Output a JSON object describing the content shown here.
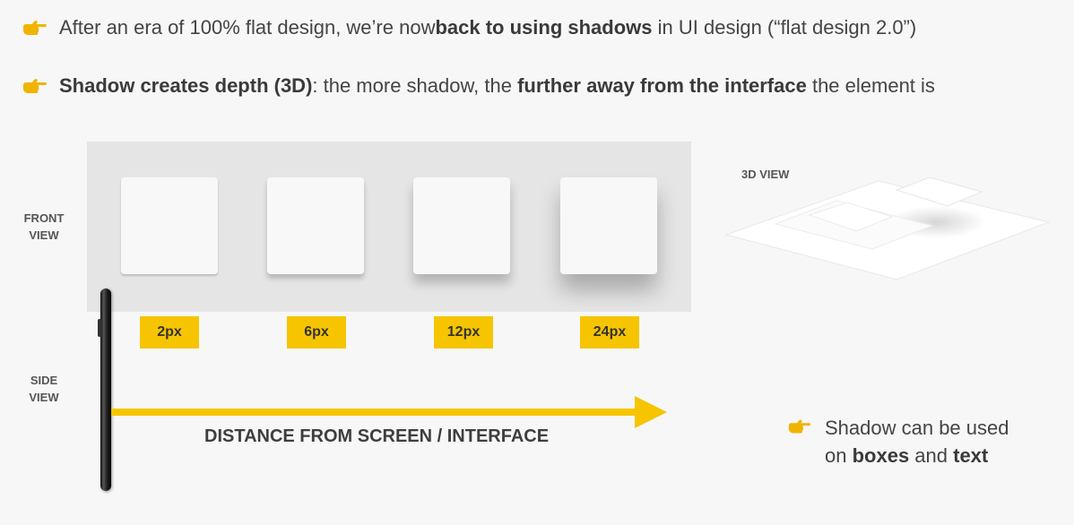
{
  "bullets": [
    {
      "prefix": "After an era of 100% flat design, we’re now ",
      "bold": "back to using shadows",
      "suffix": " in UI design (“flat design 2.0”)"
    },
    {
      "bold1": "Shadow creates depth (3D)",
      "mid": ": the more shadow, the ",
      "bold2": "further away from the interface",
      "suffix": " the element is"
    }
  ],
  "front_view_label_line1": "FRONT",
  "front_view_label_line2": "VIEW",
  "side_view_label_line1": "SIDE",
  "side_view_label_line2": "VIEW",
  "shadow_sizes": [
    "2px",
    "6px",
    "12px",
    "24px"
  ],
  "distance_label": "DISTANCE FROM SCREEN / INTERFACE",
  "view_3d_label": "3D VIEW",
  "note": {
    "line1": "Shadow can be used",
    "on": "on ",
    "boxes": "boxes",
    "and": " and ",
    "text": "text"
  },
  "colors": {
    "accent_yellow": "#f6c500",
    "hand_icon": "#f0b400",
    "panel_gray": "#e5e5e5",
    "background": "#f7f7f7"
  },
  "icons": {
    "bullet": "pointing-hand-icon",
    "device": "phone-side-icon",
    "arrow": "right-arrow-icon"
  }
}
